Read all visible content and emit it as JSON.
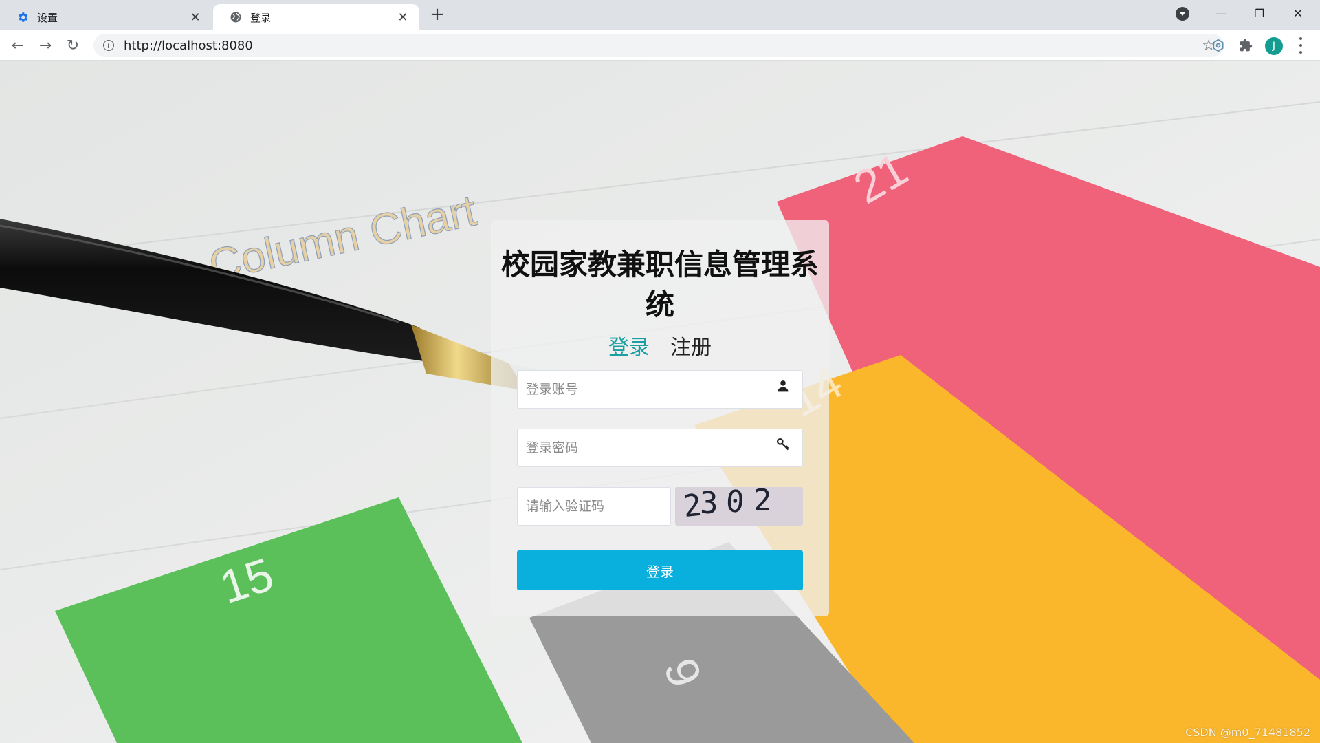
{
  "browser": {
    "tabs": [
      {
        "title": "设置",
        "icon": "gear-icon"
      },
      {
        "title": "登录",
        "icon": "globe-icon"
      }
    ],
    "url": "http://localhost:8080",
    "profile_initial": "J"
  },
  "background": {
    "heading": "Column Chart",
    "bar_labels": [
      "15",
      "9",
      "14",
      "21"
    ],
    "bar_colors": [
      "#5cc05a",
      "#9a9a9a",
      "#fbb72c",
      "#f0617a"
    ]
  },
  "login": {
    "title": "校园家教兼职信息管理系统",
    "tab_login": "登录",
    "tab_register": "注册",
    "username_placeholder": "登录账号",
    "password_placeholder": "登录密码",
    "captcha_placeholder": "请输入验证码",
    "captcha_code": [
      "2",
      "3",
      "0",
      "2"
    ],
    "submit_label": "登录",
    "accent_color": "#09b0de"
  },
  "credit": "CSDN @m0_71481852"
}
